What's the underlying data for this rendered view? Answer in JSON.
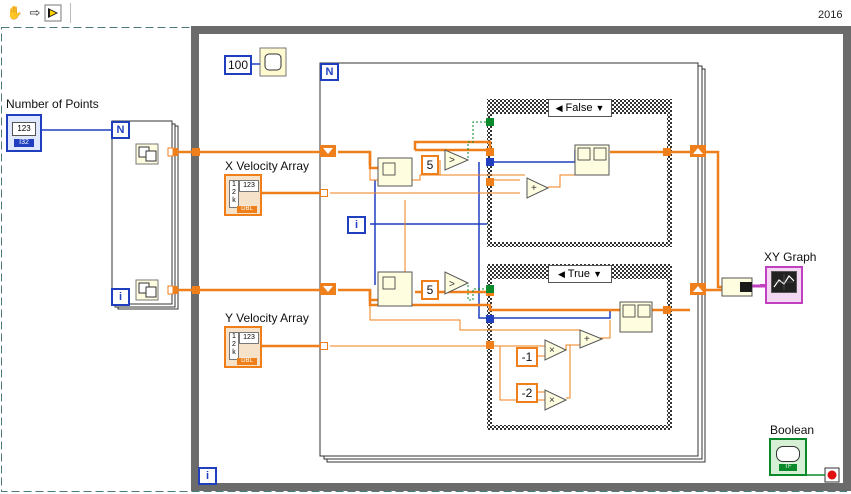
{
  "toolbar": {
    "icons": [
      "hand-icon",
      "arrow-right-icon",
      "run-icon"
    ],
    "version": "2016"
  },
  "controls": {
    "number_of_points": {
      "label": "Number of Points",
      "value": "123",
      "type": "I32"
    },
    "x_velocity_array": {
      "label": "X Velocity Array",
      "rows": [
        "1",
        "2",
        "k"
      ],
      "value": "123",
      "type": "DBL"
    },
    "y_velocity_array": {
      "label": "Y Velocity Array",
      "rows": [
        "1",
        "2",
        "k"
      ],
      "value": "123",
      "type": "DBL"
    }
  },
  "indicators": {
    "xy_graph": {
      "label": "XY Graph"
    },
    "boolean": {
      "label": "Boolean",
      "type": "TF"
    }
  },
  "constants": {
    "wait_ms": "100",
    "threshold_x": "5",
    "threshold_y": "5",
    "neg_one": "-1",
    "neg_two": "-2"
  },
  "structures": {
    "while_loop_iter": "i",
    "for_loop_count": "N",
    "for_loop_iter": "i",
    "inner_for_count": "N",
    "inner_iter": "i",
    "case_top": "False",
    "case_bottom": "True"
  },
  "colors": {
    "wire_orange": "#ee7f1a",
    "wire_blue": "#1f3fbf",
    "wire_pink": "#c040c0",
    "wire_green": "#0a8a2a",
    "frame_gray": "#6b6b6b"
  }
}
